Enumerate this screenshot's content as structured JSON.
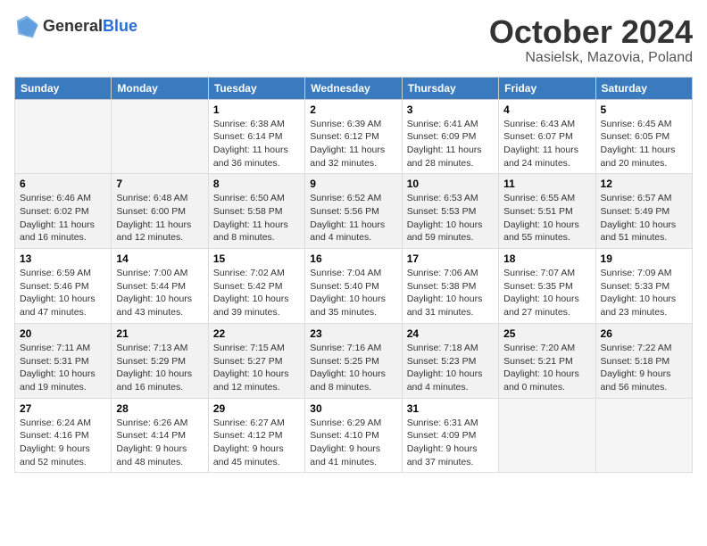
{
  "logo": {
    "general": "General",
    "blue": "Blue"
  },
  "title": "October 2024",
  "subtitle": "Nasielsk, Mazovia, Poland",
  "days_of_week": [
    "Sunday",
    "Monday",
    "Tuesday",
    "Wednesday",
    "Thursday",
    "Friday",
    "Saturday"
  ],
  "weeks": [
    [
      {
        "day": "",
        "sunrise": "",
        "sunset": "",
        "daylight": ""
      },
      {
        "day": "",
        "sunrise": "",
        "sunset": "",
        "daylight": ""
      },
      {
        "day": "1",
        "sunrise": "Sunrise: 6:38 AM",
        "sunset": "Sunset: 6:14 PM",
        "daylight": "Daylight: 11 hours and 36 minutes."
      },
      {
        "day": "2",
        "sunrise": "Sunrise: 6:39 AM",
        "sunset": "Sunset: 6:12 PM",
        "daylight": "Daylight: 11 hours and 32 minutes."
      },
      {
        "day": "3",
        "sunrise": "Sunrise: 6:41 AM",
        "sunset": "Sunset: 6:09 PM",
        "daylight": "Daylight: 11 hours and 28 minutes."
      },
      {
        "day": "4",
        "sunrise": "Sunrise: 6:43 AM",
        "sunset": "Sunset: 6:07 PM",
        "daylight": "Daylight: 11 hours and 24 minutes."
      },
      {
        "day": "5",
        "sunrise": "Sunrise: 6:45 AM",
        "sunset": "Sunset: 6:05 PM",
        "daylight": "Daylight: 11 hours and 20 minutes."
      }
    ],
    [
      {
        "day": "6",
        "sunrise": "Sunrise: 6:46 AM",
        "sunset": "Sunset: 6:02 PM",
        "daylight": "Daylight: 11 hours and 16 minutes."
      },
      {
        "day": "7",
        "sunrise": "Sunrise: 6:48 AM",
        "sunset": "Sunset: 6:00 PM",
        "daylight": "Daylight: 11 hours and 12 minutes."
      },
      {
        "day": "8",
        "sunrise": "Sunrise: 6:50 AM",
        "sunset": "Sunset: 5:58 PM",
        "daylight": "Daylight: 11 hours and 8 minutes."
      },
      {
        "day": "9",
        "sunrise": "Sunrise: 6:52 AM",
        "sunset": "Sunset: 5:56 PM",
        "daylight": "Daylight: 11 hours and 4 minutes."
      },
      {
        "day": "10",
        "sunrise": "Sunrise: 6:53 AM",
        "sunset": "Sunset: 5:53 PM",
        "daylight": "Daylight: 10 hours and 59 minutes."
      },
      {
        "day": "11",
        "sunrise": "Sunrise: 6:55 AM",
        "sunset": "Sunset: 5:51 PM",
        "daylight": "Daylight: 10 hours and 55 minutes."
      },
      {
        "day": "12",
        "sunrise": "Sunrise: 6:57 AM",
        "sunset": "Sunset: 5:49 PM",
        "daylight": "Daylight: 10 hours and 51 minutes."
      }
    ],
    [
      {
        "day": "13",
        "sunrise": "Sunrise: 6:59 AM",
        "sunset": "Sunset: 5:46 PM",
        "daylight": "Daylight: 10 hours and 47 minutes."
      },
      {
        "day": "14",
        "sunrise": "Sunrise: 7:00 AM",
        "sunset": "Sunset: 5:44 PM",
        "daylight": "Daylight: 10 hours and 43 minutes."
      },
      {
        "day": "15",
        "sunrise": "Sunrise: 7:02 AM",
        "sunset": "Sunset: 5:42 PM",
        "daylight": "Daylight: 10 hours and 39 minutes."
      },
      {
        "day": "16",
        "sunrise": "Sunrise: 7:04 AM",
        "sunset": "Sunset: 5:40 PM",
        "daylight": "Daylight: 10 hours and 35 minutes."
      },
      {
        "day": "17",
        "sunrise": "Sunrise: 7:06 AM",
        "sunset": "Sunset: 5:38 PM",
        "daylight": "Daylight: 10 hours and 31 minutes."
      },
      {
        "day": "18",
        "sunrise": "Sunrise: 7:07 AM",
        "sunset": "Sunset: 5:35 PM",
        "daylight": "Daylight: 10 hours and 27 minutes."
      },
      {
        "day": "19",
        "sunrise": "Sunrise: 7:09 AM",
        "sunset": "Sunset: 5:33 PM",
        "daylight": "Daylight: 10 hours and 23 minutes."
      }
    ],
    [
      {
        "day": "20",
        "sunrise": "Sunrise: 7:11 AM",
        "sunset": "Sunset: 5:31 PM",
        "daylight": "Daylight: 10 hours and 19 minutes."
      },
      {
        "day": "21",
        "sunrise": "Sunrise: 7:13 AM",
        "sunset": "Sunset: 5:29 PM",
        "daylight": "Daylight: 10 hours and 16 minutes."
      },
      {
        "day": "22",
        "sunrise": "Sunrise: 7:15 AM",
        "sunset": "Sunset: 5:27 PM",
        "daylight": "Daylight: 10 hours and 12 minutes."
      },
      {
        "day": "23",
        "sunrise": "Sunrise: 7:16 AM",
        "sunset": "Sunset: 5:25 PM",
        "daylight": "Daylight: 10 hours and 8 minutes."
      },
      {
        "day": "24",
        "sunrise": "Sunrise: 7:18 AM",
        "sunset": "Sunset: 5:23 PM",
        "daylight": "Daylight: 10 hours and 4 minutes."
      },
      {
        "day": "25",
        "sunrise": "Sunrise: 7:20 AM",
        "sunset": "Sunset: 5:21 PM",
        "daylight": "Daylight: 10 hours and 0 minutes."
      },
      {
        "day": "26",
        "sunrise": "Sunrise: 7:22 AM",
        "sunset": "Sunset: 5:18 PM",
        "daylight": "Daylight: 9 hours and 56 minutes."
      }
    ],
    [
      {
        "day": "27",
        "sunrise": "Sunrise: 6:24 AM",
        "sunset": "Sunset: 4:16 PM",
        "daylight": "Daylight: 9 hours and 52 minutes."
      },
      {
        "day": "28",
        "sunrise": "Sunrise: 6:26 AM",
        "sunset": "Sunset: 4:14 PM",
        "daylight": "Daylight: 9 hours and 48 minutes."
      },
      {
        "day": "29",
        "sunrise": "Sunrise: 6:27 AM",
        "sunset": "Sunset: 4:12 PM",
        "daylight": "Daylight: 9 hours and 45 minutes."
      },
      {
        "day": "30",
        "sunrise": "Sunrise: 6:29 AM",
        "sunset": "Sunset: 4:10 PM",
        "daylight": "Daylight: 9 hours and 41 minutes."
      },
      {
        "day": "31",
        "sunrise": "Sunrise: 6:31 AM",
        "sunset": "Sunset: 4:09 PM",
        "daylight": "Daylight: 9 hours and 37 minutes."
      },
      {
        "day": "",
        "sunrise": "",
        "sunset": "",
        "daylight": ""
      },
      {
        "day": "",
        "sunrise": "",
        "sunset": "",
        "daylight": ""
      }
    ]
  ]
}
